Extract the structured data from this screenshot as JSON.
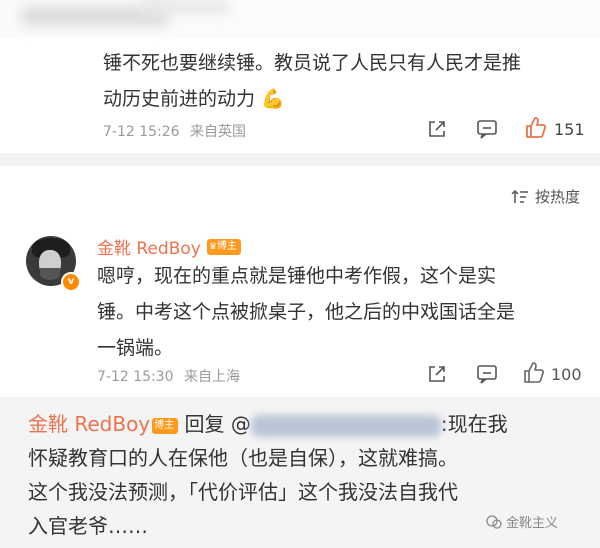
{
  "comment1": {
    "text_line1": "锤不死也要继续锤。教员说了人民只有人民才是推",
    "text_line2": "动历史前进的动力",
    "emoji": "💪",
    "time": "7-12 15:26",
    "source": "来自英国",
    "likes": "151",
    "colors": {
      "like": "#eb7350"
    }
  },
  "sort": {
    "label": "按热度"
  },
  "comment2": {
    "username": "金靴 RedBoy",
    "tag": "博主",
    "text_line1": "嗯哼，现在的重点就是锤他中考作假，这个是实",
    "text_line2": "锤。中考这个点被掀桌子，他之后的中戏国话全是",
    "text_line3": "一锅端。",
    "time": "7-12 15:30",
    "source": "来自上海",
    "likes": "100"
  },
  "reply": {
    "username": "金靴 RedBoy",
    "tag": "博主",
    "prefix": "回复 @",
    "after_mention": ":现在我",
    "line2": "怀疑教育口的人在保他（也是自保），这就难搞。",
    "line3": "这个我没法预测，「代价评估」这个我没法自我代",
    "line4": "入官老爷……"
  },
  "watermark": {
    "text": "金靴主义"
  }
}
